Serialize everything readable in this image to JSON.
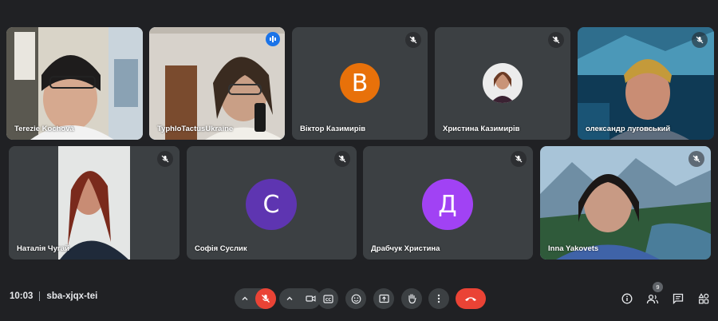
{
  "participants": [
    {
      "name": "Terezie Kochová",
      "type": "video",
      "muted": false
    },
    {
      "name": "TyphloTactusUkraine",
      "type": "video",
      "speaking": true
    },
    {
      "name": "Віктор Казимирів",
      "type": "avatar",
      "initial": "В",
      "avatar_color": "#e8710a",
      "muted": true
    },
    {
      "name": "Христина Казимирів",
      "type": "photo",
      "muted": true
    },
    {
      "name": "олександр луговський",
      "type": "video",
      "muted": true
    },
    {
      "name": "Наталія Чугай",
      "type": "video",
      "muted": true
    },
    {
      "name": "Софія Суслик",
      "type": "avatar",
      "initial": "С",
      "avatar_color": "#5e35b1",
      "muted": true
    },
    {
      "name": "Драбчук Христина",
      "type": "avatar",
      "initial": "Д",
      "avatar_color": "#a142f4",
      "muted": true
    },
    {
      "name": "Inna Yakovets",
      "type": "video",
      "muted": true
    }
  ],
  "meeting": {
    "time": "10:03",
    "code": "sba-xjqx-tei"
  },
  "controls": {
    "mic": "mic-off-icon",
    "camera": "camera-icon",
    "captions": "captions-icon",
    "emoji": "emoji-icon",
    "present": "present-icon",
    "hand": "raise-hand-icon",
    "more": "more-vert-icon",
    "leave": "end-call-icon"
  },
  "side_controls": {
    "people_count": "9",
    "icons": [
      "info-icon",
      "people-icon",
      "chat-icon",
      "activities-icon"
    ]
  },
  "colors": {
    "background": "#202124",
    "tile": "#3c4043",
    "danger": "#ea4335",
    "active_outline": "#8ab4f8"
  }
}
